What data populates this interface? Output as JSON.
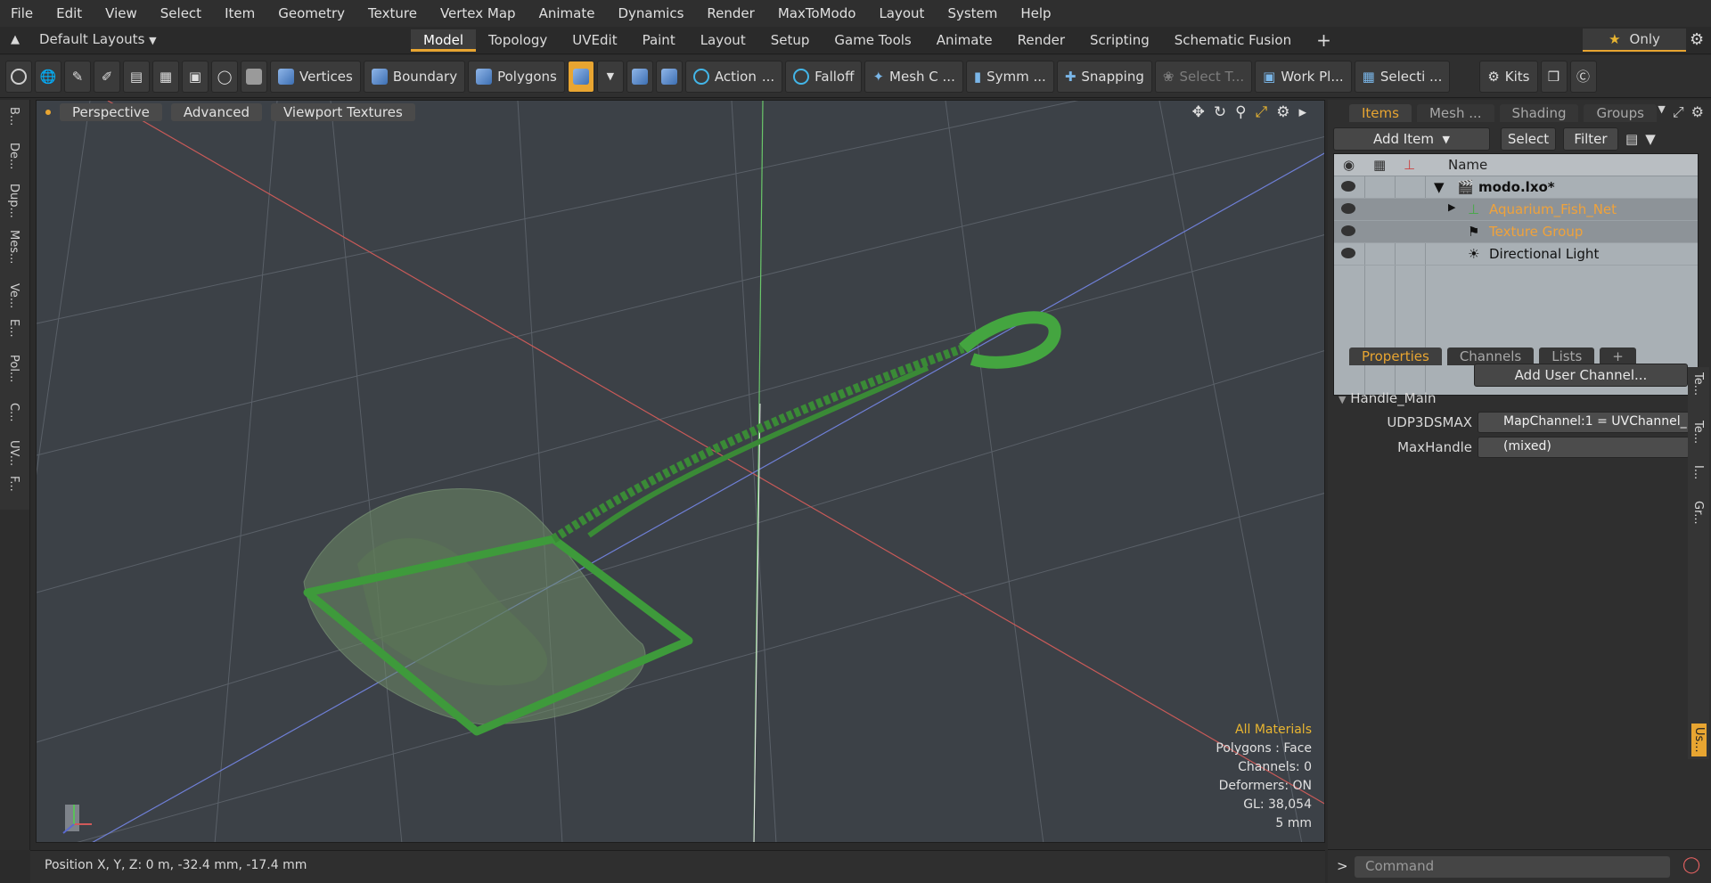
{
  "menu": [
    "File",
    "Edit",
    "View",
    "Select",
    "Item",
    "Geometry",
    "Texture",
    "Vertex Map",
    "Animate",
    "Dynamics",
    "Render",
    "MaxToModo",
    "Layout",
    "System",
    "Help"
  ],
  "layouts_label": "Default Layouts",
  "mode_tabs": [
    "Model",
    "Topology",
    "UVEdit",
    "Paint",
    "Layout",
    "Setup",
    "Game Tools",
    "Animate",
    "Render",
    "Scripting",
    "Schematic Fusion",
    "+"
  ],
  "active_mode_tab": "Model",
  "only_label": "Only",
  "toolbar": {
    "vertices": "Vertices",
    "boundary": "Boundary",
    "polygons": "Polygons",
    "action": "Action",
    "action_dots": "...",
    "falloff": "Falloff",
    "mesh": "Mesh C ...",
    "symm": "Symm ...",
    "snapping": "Snapping",
    "select_t": "Select T...",
    "work_pl": "Work Pl...",
    "selecti": "Selecti ...",
    "kits": "Kits"
  },
  "left_tabs": [
    "B...",
    "De...",
    "Dup...",
    "Mes...",
    "Ve...",
    "E...",
    "Pol...",
    "C...",
    "UV...",
    "F..."
  ],
  "viewport": {
    "buttons": [
      "Perspective",
      "Advanced",
      "Viewport Textures"
    ],
    "info": {
      "materials": "All Materials",
      "polygons": "Polygons : Face",
      "channels": "Channels: 0",
      "deformers": "Deformers: ON",
      "gl": "GL: 38,054",
      "unit": "5 mm"
    }
  },
  "status": "Position X, Y, Z:   0 m, -32.4 mm, -17.4 mm",
  "items_panel": {
    "tabs": [
      "Items",
      "Mesh ...",
      "Shading",
      "Groups"
    ],
    "add_item": "Add Item",
    "select": "Select",
    "filter": "Filter",
    "name_header": "Name",
    "rows": [
      {
        "label": "modo.lxo*",
        "style": "bold",
        "indent": 0
      },
      {
        "label": "Aquarium_Fish_Net",
        "style": "orange",
        "indent": 1
      },
      {
        "label": "Texture Group",
        "style": "orange",
        "indent": 1
      },
      {
        "label": "Directional Light",
        "style": "normal",
        "indent": 1
      }
    ]
  },
  "props_panel": {
    "tabs": [
      "Properties",
      "Channels",
      "Lists",
      "+"
    ],
    "add_user_channel": "Add User Channel...",
    "section": "Handle_Main",
    "rows": [
      {
        "label": "UDP3DSMAX",
        "value": "MapChannel:1 = UVChannel_"
      },
      {
        "label": "MaxHandle",
        "value": "(mixed)"
      }
    ],
    "side_tabs": [
      "Te...",
      "Te...",
      "I...",
      "Gr...",
      "Us..."
    ]
  },
  "command_placeholder": "Command",
  "colors": {
    "accent": "#e8a531",
    "net_green": "#3f8a3a",
    "viewport_bg": "#3c4147"
  }
}
